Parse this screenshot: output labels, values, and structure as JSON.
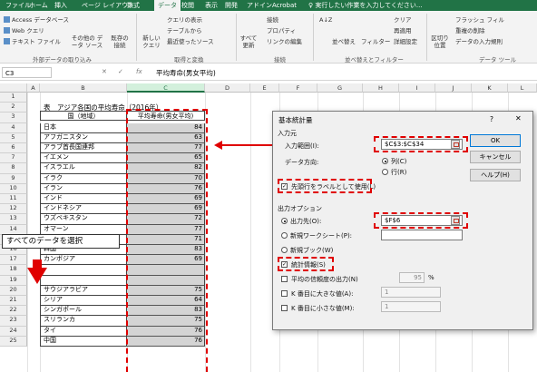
{
  "ribbon_tabs": [
    "ファイル",
    "ホーム",
    "挿入",
    "ページ レイアウト",
    "数式",
    "データ",
    "校閲",
    "表示",
    "開発",
    "アドイン",
    "Acrobat",
    "♀ 実行したい作業を入力してください..."
  ],
  "ribbon": {
    "access": "Access データベース",
    "web": "Web クエリ",
    "text": "テキスト ファイル",
    "other": "その他の データ ソース",
    "existing": "既存の 接続",
    "newquery": "新しい クエリ",
    "show_query": "クエリの表示",
    "from_table": "テーブルから",
    "recent": "最近使ったソース",
    "refresh": "すべて 更新",
    "connections": "接続",
    "properties": "プロパティ",
    "edit_links": "リンクの編集",
    "sort_az": "A↓Z",
    "sort": "並べ替え",
    "filter": "フィルター",
    "clear": "クリア",
    "reapply": "再適用",
    "advanced": "詳細設定",
    "text_to_cols": "区切り位置",
    "flash_fill": "フラッシュ フィル",
    "remove_dup": "重複の削除",
    "data_validation": "データの入力規則",
    "group_external": "外部データの取り込み",
    "group_transform": "取得と変換",
    "group_connections": "接続",
    "group_sort": "並べ替えとフィルター",
    "group_tools": "データ ツール"
  },
  "formula_bar": {
    "name_box": "C3",
    "cancel": "✕",
    "enter": "✓",
    "fx": "fx",
    "formula": "平均寿命(男女平均)"
  },
  "columns": [
    "A",
    "B",
    "C",
    "D",
    "E",
    "F",
    "G",
    "H",
    "I",
    "J",
    "K",
    "L"
  ],
  "rows": [
    "1",
    "2",
    "3",
    "4",
    "5",
    "6",
    "7",
    "8",
    "9",
    "10",
    "11",
    "12",
    "13",
    "14",
    "15",
    "16",
    "17",
    "18",
    "19",
    "20",
    "21",
    "22",
    "23",
    "24",
    "25"
  ],
  "sheet": {
    "title": "表　アジア各国の平均寿命（2016年）",
    "header_b": "国（地域）",
    "header_c": "平均寿命(男女平均)",
    "countries": [
      "日本",
      "アフガニスタン",
      "アラブ首長国連邦",
      "イエメン",
      "イスラエル",
      "イラク",
      "イラン",
      "インド",
      "インドネシア",
      "ウズベキスタン",
      "オマーン",
      "カザフスタン",
      "韓国",
      "カンボジア",
      "",
      "",
      "サウジアラビア",
      "シリア",
      "シンガポール",
      "スリランカ",
      "タイ",
      "中国"
    ],
    "values": [
      "84",
      "63",
      "77",
      "65",
      "82",
      "70",
      "76",
      "69",
      "69",
      "72",
      "77",
      "71",
      "83",
      "69",
      "",
      "",
      "75",
      "64",
      "83",
      "75",
      "76",
      "76"
    ]
  },
  "callout": "すべてのデータを選択",
  "dialog": {
    "title": "基本統計量",
    "help": "?",
    "close": "✕",
    "input_section": "入力元",
    "input_range_label": "入力範囲(I):",
    "input_range": "$C$3:$C$34",
    "data_direction": "データ方向:",
    "col_label": "列(C)",
    "row_label": "行(R)",
    "first_row_label": "先頭行をラベルとして使用(L)",
    "output_section": "出力オプション",
    "output_dest": "出力先(O):",
    "output_value": "$F$6",
    "new_sheet": "新規ワークシート(P):",
    "new_book": "新規ブック(W)",
    "summary": "統計情報(S)",
    "confidence": "平均の信頼度の出力(N)",
    "confidence_value": "95",
    "percent": "%",
    "kth_large": "K 番目に大きな値(A):",
    "kth_large_value": "1",
    "kth_small": "K 番目に小さな値(M):",
    "kth_small_value": "1",
    "ok": "OK",
    "cancel": "キャンセル",
    "help_btn": "ヘルプ(H)"
  }
}
